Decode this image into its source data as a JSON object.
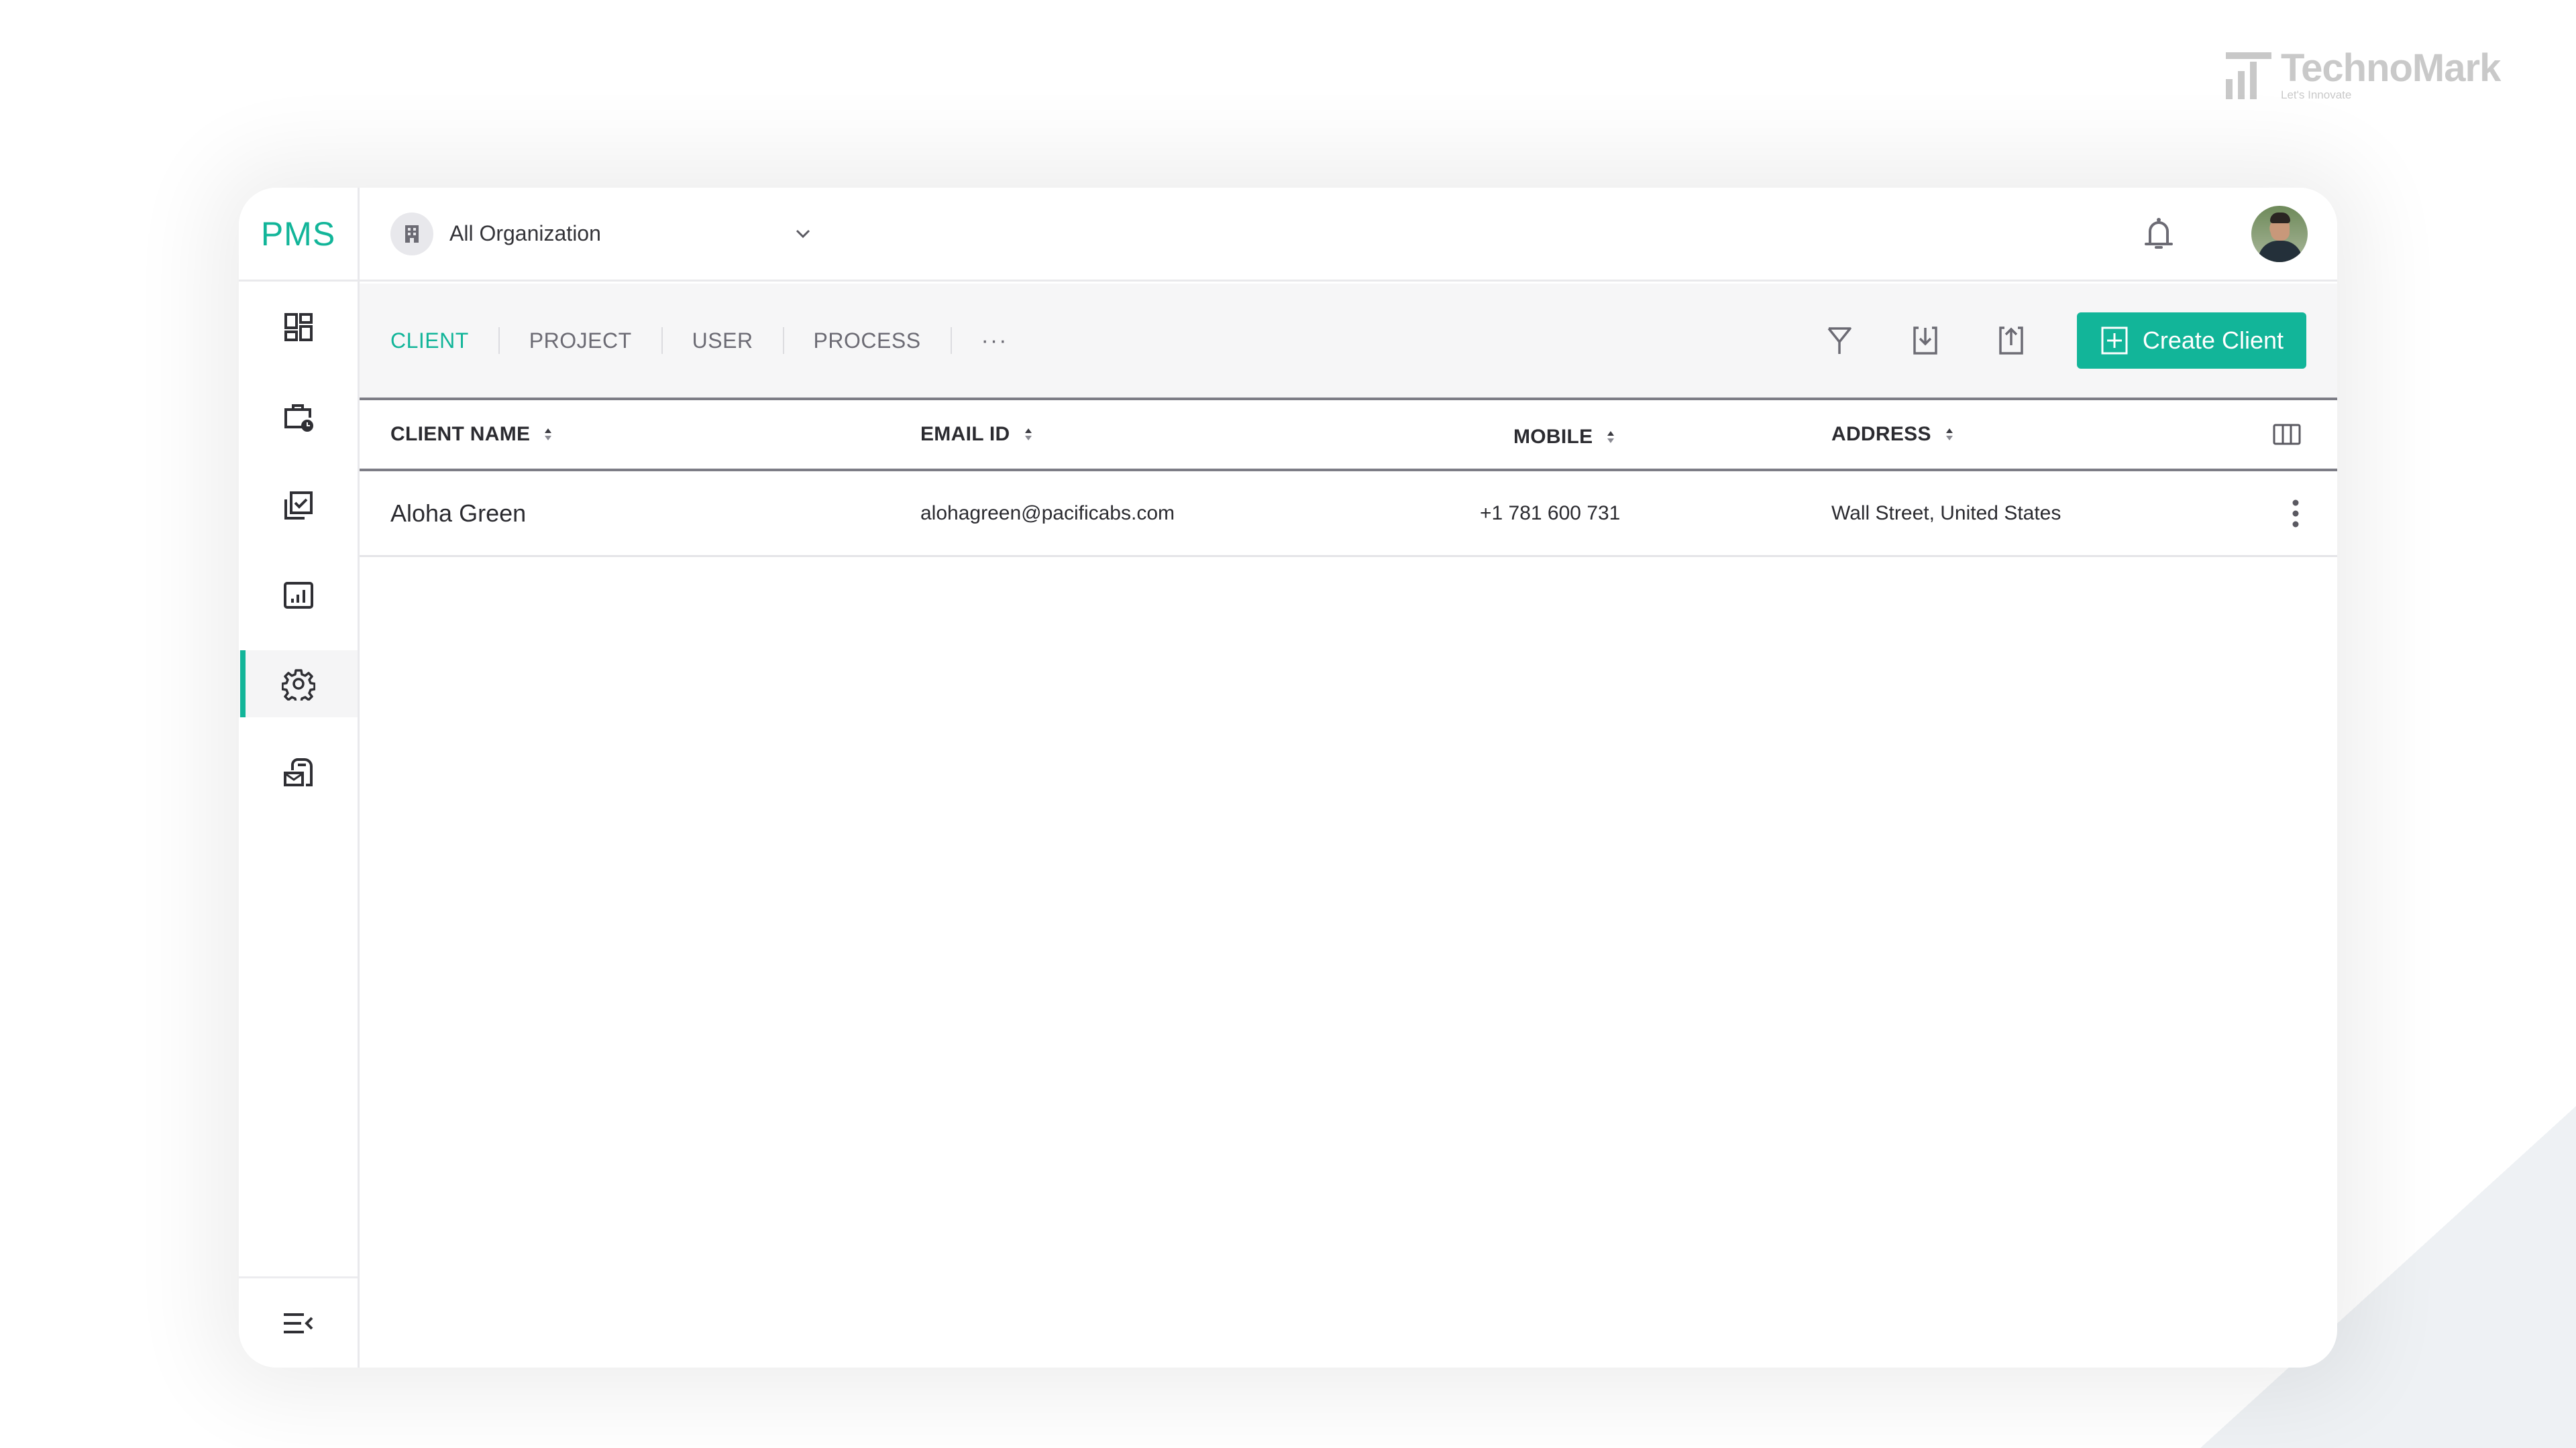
{
  "brand": {
    "name": "TechnoMark",
    "tagline": "Let's Innovate"
  },
  "app": {
    "logo": "PMS",
    "accent_color": "#12b599"
  },
  "header": {
    "org_selector": {
      "value": "All Organization",
      "icon": "building-icon"
    },
    "notification_icon": "bell-icon",
    "avatar_icon": "user-avatar"
  },
  "sidebar": {
    "items": [
      {
        "icon": "dashboard-icon",
        "active": false
      },
      {
        "icon": "briefcase-clock-icon",
        "active": false
      },
      {
        "icon": "tasks-check-icon",
        "active": false
      },
      {
        "icon": "reports-chart-icon",
        "active": false
      },
      {
        "icon": "settings-gear-icon",
        "active": true
      },
      {
        "icon": "mailbox-icon",
        "active": false
      }
    ],
    "collapse_icon": "collapse-menu-icon"
  },
  "toolbar": {
    "tabs": [
      {
        "label": "CLIENT",
        "active": true
      },
      {
        "label": "PROJECT",
        "active": false
      },
      {
        "label": "USER",
        "active": false
      },
      {
        "label": "PROCESS",
        "active": false
      }
    ],
    "more_label": "···",
    "tools": [
      "filter-icon",
      "download-icon",
      "upload-icon"
    ],
    "create_label": "Create Client"
  },
  "table": {
    "columns": [
      {
        "label": "CLIENT NAME",
        "sortable": true
      },
      {
        "label": "EMAIL ID",
        "sortable": true
      },
      {
        "label": "MOBILE",
        "sortable": true
      },
      {
        "label": "ADDRESS",
        "sortable": true
      }
    ],
    "rows": [
      {
        "client_name": "Aloha Green",
        "email": "alohagreen@pacificabs.com",
        "mobile": "+1 781 600 731",
        "address": "Wall Street, United States"
      }
    ]
  }
}
